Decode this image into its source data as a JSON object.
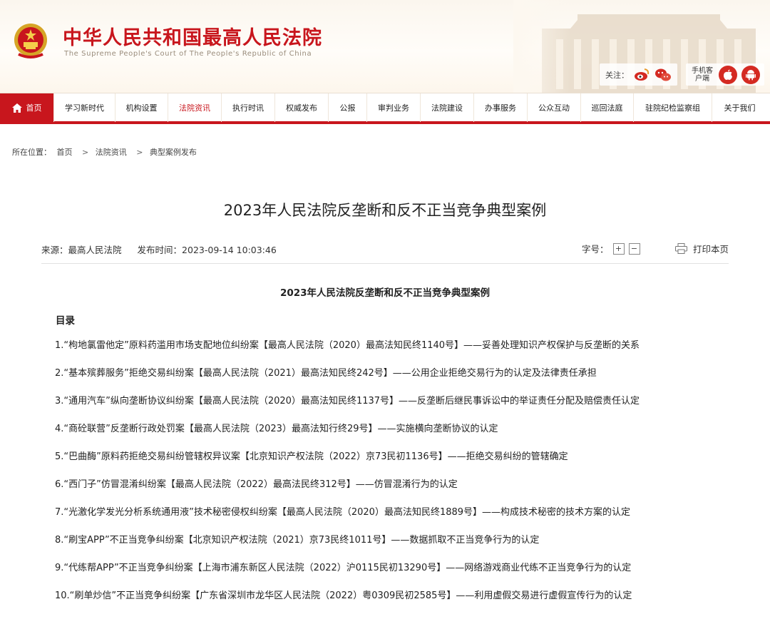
{
  "header": {
    "title_cn": "中华人民共和国最高人民法院",
    "title_en": "The Supreme People's Court of The People's Republic of China",
    "follow_label": "关注：",
    "mobile_label": "手机客户端",
    "icons": [
      "weibo-icon",
      "wechat-icon",
      "apple-icon",
      "android-icon"
    ]
  },
  "nav": {
    "items": [
      {
        "label": "首页"
      },
      {
        "label": "学习新时代"
      },
      {
        "label": "机构设置"
      },
      {
        "label": "法院资讯"
      },
      {
        "label": "执行时讯"
      },
      {
        "label": "权威发布"
      },
      {
        "label": "公报"
      },
      {
        "label": "审判业务"
      },
      {
        "label": "法院建设"
      },
      {
        "label": "办事服务"
      },
      {
        "label": "公众互动"
      },
      {
        "label": "巡回法庭"
      },
      {
        "label": "驻院纪检监察组"
      },
      {
        "label": "关于我们"
      }
    ],
    "active_index": 3
  },
  "breadcrumb": {
    "prefix": "所在位置：",
    "items": [
      "首页",
      "法院资讯",
      "典型案例发布"
    ],
    "separator": ">"
  },
  "article": {
    "title": "2023年人民法院反垄断和反不正当竞争典型案例",
    "source_label": "来源：",
    "source": "最高人民法院",
    "publish_label": "发布时间：",
    "publish_time": "2023-09-14 10:03:46",
    "font_size_label": "字号：",
    "font_plus": "+",
    "font_minus": "−",
    "print_label": "打印本页"
  },
  "content": {
    "title": "2023年人民法院反垄断和反不正当竞争典型案例",
    "toc_heading": "目录",
    "cases": [
      "1.“枸地氯雷他定”原料药滥用市场支配地位纠纷案【最高人民法院（2020）最高法知民终1140号】——妥善处理知识产权保护与反垄断的关系",
      "2.“基本殡葬服务”拒绝交易纠纷案【最高人民法院（2021）最高法知民终242号】——公用企业拒绝交易行为的认定及法律责任承担",
      "3.“通用汽车”纵向垄断协议纠纷案【最高人民法院（2020）最高法知民终1137号】——反垄断后继民事诉讼中的举证责任分配及赔偿责任认定",
      "4.“商砼联营”反垄断行政处罚案【最高人民法院（2023）最高法知行终29号】——实施横向垄断协议的认定",
      "5.“巴曲酶”原料药拒绝交易纠纷管辖权异议案【北京知识产权法院（2022）京73民初1136号】——拒绝交易纠纷的管辖确定",
      "6.“西门子”仿冒混淆纠纷案【最高人民法院（2022）最高法民终312号】——仿冒混淆行为的认定",
      "7.“光激化学发光分析系统通用液”技术秘密侵权纠纷案【最高人民法院（2020）最高法知民终1889号】——构成技术秘密的技术方案的认定",
      "8.“刷宝APP”不正当竞争纠纷案【北京知识产权法院（2021）京73民终1011号】——数据抓取不正当竞争行为的认定",
      "9.“代练帮APP”不正当竞争纠纷案【上海市浦东新区人民法院（2022）沪0115民初13290号】——网络游戏商业代练不正当竞争行为的认定",
      "10.“刷单炒信”不正当竞争纠纷案【广东省深圳市龙华区人民法院（2022）粤0309民初2585号】——利用虚假交易进行虚假宣传行为的认定"
    ]
  },
  "colors": {
    "brand_red": "#c8161d",
    "text": "#222222"
  }
}
